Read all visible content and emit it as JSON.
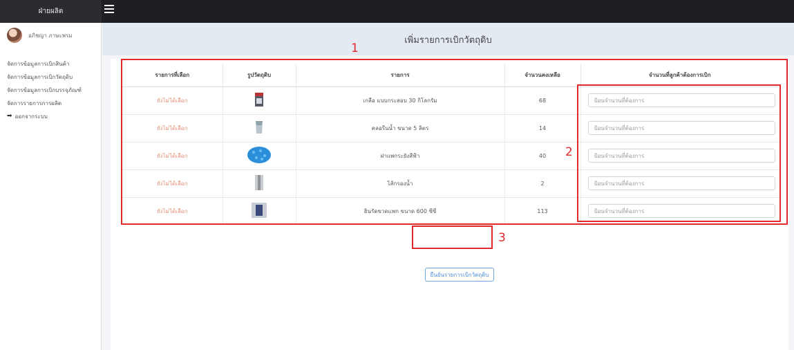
{
  "app": {
    "brand": "ฝ่ายผลิต"
  },
  "user": {
    "name": "อภิชญา ภาษะพรม"
  },
  "sidebar": {
    "items": [
      {
        "label": "จัดการข้อมูลการเบิกสินค้า"
      },
      {
        "label": "จัดการข้อมูลการเบิกวัตถุดิบ"
      },
      {
        "label": "จัดการข้อมูลการเบิกบรรจุภัณฑ์"
      },
      {
        "label": "จัดการรายการการผลิต"
      }
    ],
    "logout": "ออกจากระบบ"
  },
  "page": {
    "title": "เพิ่มรายการเบิกวัตถุดิบ"
  },
  "table": {
    "columns": [
      "รายการที่เลือก",
      "รูปวัตถุดิบ",
      "รายการ",
      "จำนวนคงเหลือ",
      "จำนวนที่ลูกค้าต้องการเบิก"
    ],
    "rows": [
      {
        "status": "ยังไม่ได้เลือก",
        "image": "bag-image",
        "name": "เกลือ แบบกระสอบ 30 กิโลกรัม",
        "remaining": "68",
        "placeholder": "ป้อนจำนวนที่ต้องการ"
      },
      {
        "status": "ยังไม่ได้เลือก",
        "image": "bottle-image",
        "name": "คลอรีนน้ำ ขนาด 5 ลิตร",
        "remaining": "14",
        "placeholder": "ป้อนจำนวนที่ต้องการ"
      },
      {
        "status": "ยังไม่ได้เลือก",
        "image": "blue-caps-image",
        "name": "ฝาแพกระยังสีฟ้า",
        "remaining": "40",
        "placeholder": "ป้อนจำนวนที่ต้องการ"
      },
      {
        "status": "ยังไม่ได้เลือก",
        "image": "filter-cartridge-image",
        "name": "ไส้กรองน้ำ",
        "remaining": "2",
        "placeholder": "ป้อนจำนวนที่ต้องการ"
      },
      {
        "status": "ยังไม่ได้เลือก",
        "image": "bottle-pack-image",
        "name": "ฮินรัดขวดแพก ขนาด 600 ซีซี",
        "remaining": "113",
        "placeholder": "ป้อนจำนวนที่ต้องการ"
      }
    ]
  },
  "confirm_label": "ยืนยันรายการเบิกวัตถุดิบ",
  "annotations": [
    "1",
    "2",
    "3"
  ],
  "colors": {
    "annotation": "#e0282d",
    "status": "#e8917a",
    "button": "#4b8ed6"
  },
  "icons": {
    "menu": "hamburger-icon",
    "logout": "sign-out-icon"
  }
}
